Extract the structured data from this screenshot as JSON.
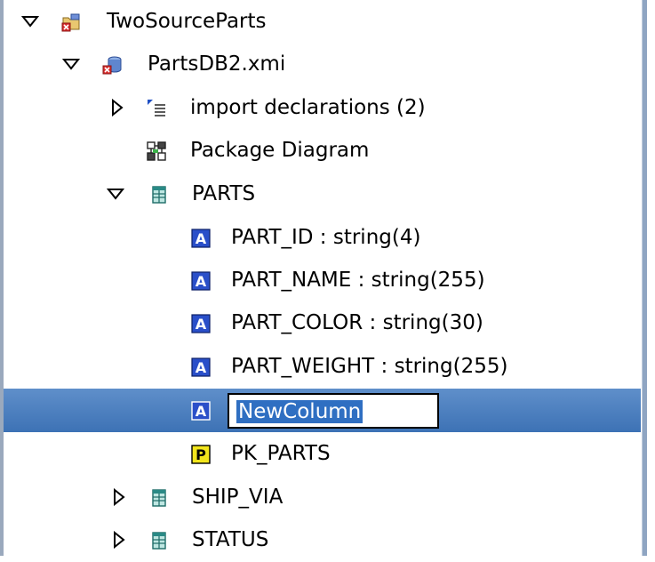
{
  "tree": {
    "items": [
      {
        "label": "TwoSourceParts",
        "icon": "project-folder-icon",
        "twisty": "expanded"
      },
      {
        "label": "PartsDB2.xmi",
        "icon": "model-database-icon",
        "twisty": "expanded"
      },
      {
        "label": "import declarations (2)",
        "icon": "import-declarations-icon",
        "twisty": "collapsed"
      },
      {
        "label": "Package Diagram",
        "icon": "package-diagram-icon",
        "twisty": "none"
      },
      {
        "label": "PARTS",
        "icon": "table-icon",
        "twisty": "expanded"
      },
      {
        "label": "PART_ID : string(4)",
        "icon": "column-attribute-icon",
        "twisty": "none"
      },
      {
        "label": "PART_NAME : string(255)",
        "icon": "column-attribute-icon",
        "twisty": "none"
      },
      {
        "label": "PART_COLOR : string(30)",
        "icon": "column-attribute-icon",
        "twisty": "none"
      },
      {
        "label": "PART_WEIGHT : string(255)",
        "icon": "column-attribute-icon",
        "twisty": "none"
      },
      {
        "label": "NewColumn",
        "icon": "column-attribute-icon",
        "twisty": "none",
        "editing": true,
        "selected": true
      },
      {
        "label": "PK_PARTS",
        "icon": "primary-key-icon",
        "twisty": "none"
      },
      {
        "label": "SHIP_VIA",
        "icon": "table-icon",
        "twisty": "collapsed"
      },
      {
        "label": "STATUS",
        "icon": "table-icon",
        "twisty": "collapsed"
      }
    ]
  },
  "colors": {
    "selection": "#3d72b5",
    "edit_highlight": "#2f6fc2",
    "attribute_icon_bg": "#2a4fc9",
    "pk_icon_bg": "#f2e51c",
    "table_icon": "#2a8a86"
  }
}
